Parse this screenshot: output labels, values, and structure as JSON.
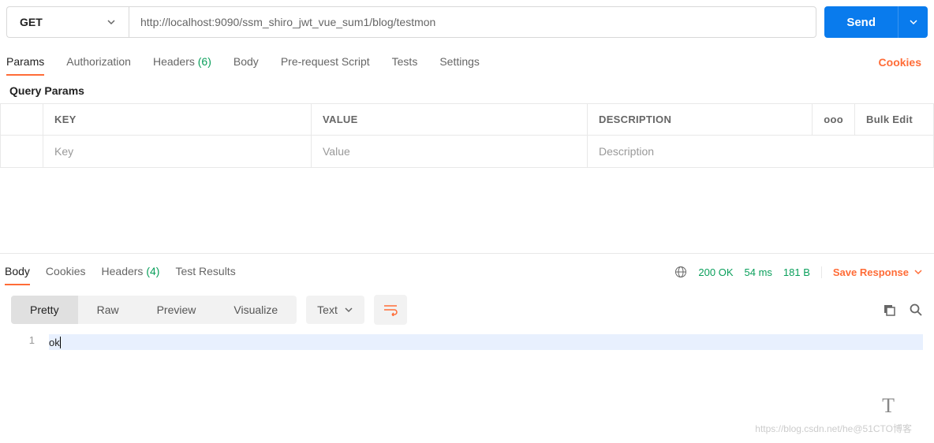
{
  "request": {
    "method": "GET",
    "url": "http://localhost:9090/ssm_shiro_jwt_vue_sum1/blog/testmon",
    "send_label": "Send"
  },
  "tabs": {
    "items": [
      {
        "label": "Params",
        "active": true
      },
      {
        "label": "Authorization"
      },
      {
        "label": "Headers",
        "count": "(6)"
      },
      {
        "label": "Body"
      },
      {
        "label": "Pre-request Script"
      },
      {
        "label": "Tests"
      },
      {
        "label": "Settings"
      }
    ],
    "cookies_label": "Cookies"
  },
  "params": {
    "subhead": "Query Params",
    "headers": {
      "key": "KEY",
      "value": "VALUE",
      "desc": "DESCRIPTION"
    },
    "placeholders": {
      "key": "Key",
      "value": "Value",
      "desc": "Description"
    },
    "more_icon": "ooo",
    "bulk_label": "Bulk Edit"
  },
  "response": {
    "tabs": [
      {
        "label": "Body",
        "active": true
      },
      {
        "label": "Cookies"
      },
      {
        "label": "Headers",
        "count": "(4)"
      },
      {
        "label": "Test Results"
      }
    ],
    "status_code": "200 OK",
    "time": "54 ms",
    "size": "181 B",
    "save_label": "Save Response",
    "view_tabs": [
      {
        "label": "Pretty",
        "active": true
      },
      {
        "label": "Raw"
      },
      {
        "label": "Preview"
      },
      {
        "label": "Visualize"
      }
    ],
    "mime": "Text",
    "body_lines": [
      {
        "n": "1",
        "text": "ok"
      }
    ]
  },
  "watermark": "https://blog.csdn.net/he@51CTO博客"
}
